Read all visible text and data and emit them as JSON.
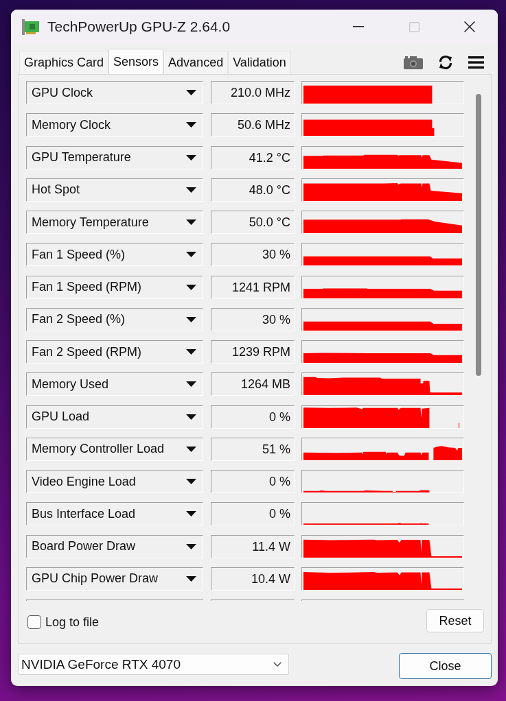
{
  "window": {
    "title": "TechPowerUp GPU-Z 2.64.0"
  },
  "tabs": [
    {
      "label": "Graphics Card",
      "selected": false
    },
    {
      "label": "Sensors",
      "selected": true
    },
    {
      "label": "Advanced",
      "selected": false
    },
    {
      "label": "Validation",
      "selected": false
    }
  ],
  "sensors": [
    {
      "name": "GPU Clock",
      "value": "210.0 MHz"
    },
    {
      "name": "Memory Clock",
      "value": "50.6 MHz"
    },
    {
      "name": "GPU Temperature",
      "value": "41.2 °C"
    },
    {
      "name": "Hot Spot",
      "value": "48.0 °C"
    },
    {
      "name": "Memory Temperature",
      "value": "50.0 °C"
    },
    {
      "name": "Fan 1 Speed (%)",
      "value": "30 %"
    },
    {
      "name": "Fan 1 Speed (RPM)",
      "value": "1241 RPM"
    },
    {
      "name": "Fan 2 Speed (%)",
      "value": "30 %"
    },
    {
      "name": "Fan 2 Speed (RPM)",
      "value": "1239 RPM"
    },
    {
      "name": "Memory Used",
      "value": "1264 MB"
    },
    {
      "name": "GPU Load",
      "value": "0 %"
    },
    {
      "name": "Memory Controller Load",
      "value": "51 %"
    },
    {
      "name": "Video Engine Load",
      "value": "0 %"
    },
    {
      "name": "Bus Interface Load",
      "value": "0 %"
    },
    {
      "name": "Board Power Draw",
      "value": "11.4 W"
    },
    {
      "name": "GPU Chip Power Draw",
      "value": "10.4 W"
    }
  ],
  "log_to_file": {
    "label": "Log to file",
    "checked": false
  },
  "reset_button": {
    "label": "Reset"
  },
  "device_select": {
    "value": "NVIDIA GeForce RTX 4070"
  },
  "close_button": {
    "label": "Close"
  }
}
